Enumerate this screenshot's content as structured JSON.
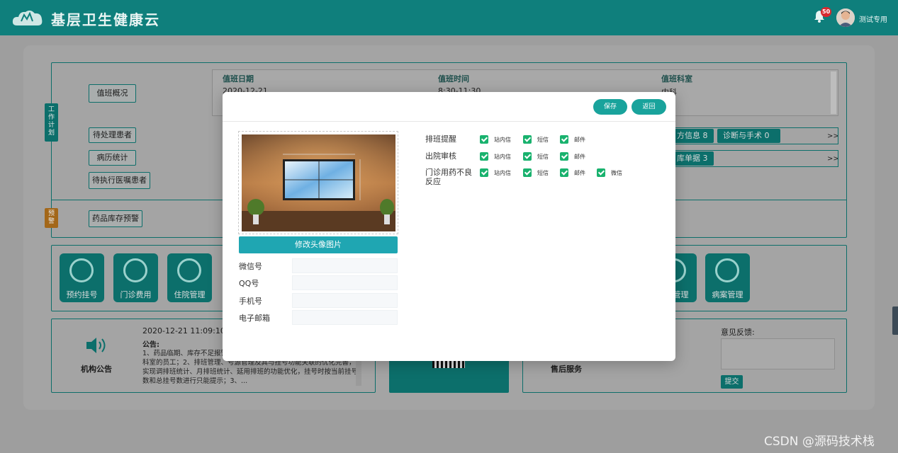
{
  "header": {
    "app_title": "基层卫生健康云",
    "notification_count": "50",
    "user_name": "测试专用"
  },
  "work_plan": {
    "side_label": "工作计划",
    "schedule": {
      "button": "值班概况",
      "columns": [
        "值班日期",
        "值班时间",
        "值班科室"
      ],
      "row": [
        "2020-12-21",
        "8:30-11:30",
        "内科"
      ]
    },
    "rows": [
      {
        "label": "待处理患者",
        "pills": [
          "方信息 8",
          "诊断与手术 0"
        ],
        "more": ">>"
      },
      {
        "label": "病历统计",
        "pills": [
          "库单据 3"
        ],
        "more": ">>"
      },
      {
        "label": "待执行医嘱患者"
      }
    ]
  },
  "warning": {
    "side_label": "预警",
    "label": "药品库存预警"
  },
  "functions": [
    "预约挂号",
    "门诊费用",
    "住院管理",
    "管理",
    "病案管理"
  ],
  "notice": {
    "title": "机构公告",
    "datetime": "2020-12-21 11:09:10",
    "heading": "公告:",
    "body": "1、药品临期、库存不足报警……对应的提示报警信息，并提醒通知对应科室的员工；2、排班管理、号源管理及其与挂号功能关联的优化完善，实现调排班统计、月排班统计、延用排班的功能优化，挂号时按当前挂号数和总挂号数进行只能提示；3、..."
  },
  "after_sales": {
    "label": "售后服务",
    "feedback_label": "意见反馈:",
    "submit": "提交"
  },
  "modal": {
    "save": "保存",
    "back": "返回",
    "change_image": "修改头像图片",
    "fields": [
      {
        "label": "微信号",
        "value": ""
      },
      {
        "label": "QQ号",
        "value": ""
      },
      {
        "label": "手机号",
        "value": ""
      },
      {
        "label": "电子邮箱",
        "value": ""
      }
    ],
    "settings": [
      {
        "label": "排班提醒",
        "options": [
          "站内信",
          "短信",
          "邮件"
        ]
      },
      {
        "label": "出院审核",
        "options": [
          "站内信",
          "短信",
          "邮件"
        ]
      },
      {
        "label": "门诊用药不良反应",
        "options": [
          "站内信",
          "短信",
          "邮件",
          "微信"
        ]
      }
    ]
  },
  "watermark": "CSDN @源码技术栈",
  "colors": {
    "header": "#0f7f7c",
    "accent": "#19a39c",
    "checkbox": "#19b26e",
    "image_button": "#1fa6b2"
  }
}
